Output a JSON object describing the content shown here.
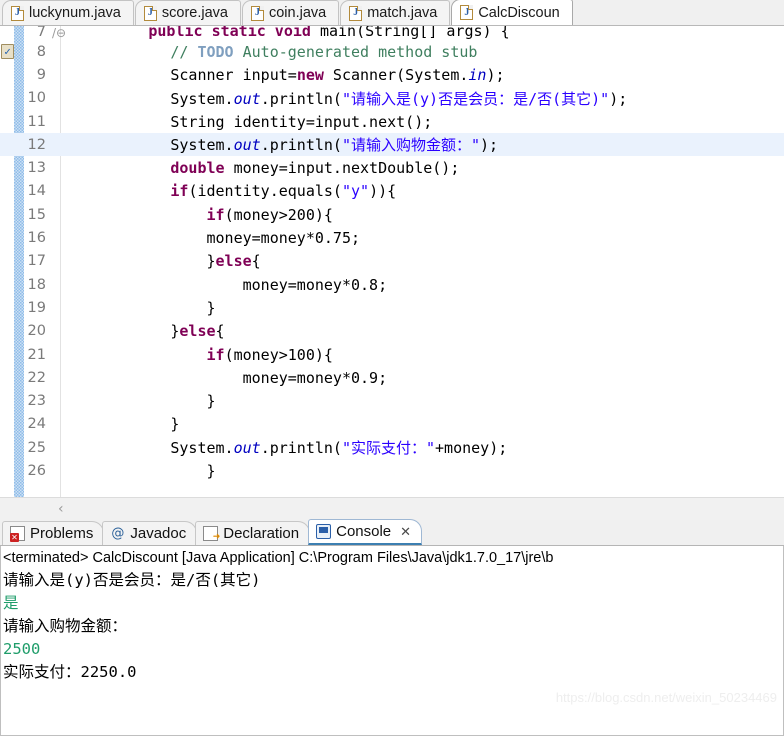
{
  "editor": {
    "tabs": [
      {
        "label": "luckynum.java",
        "icon": "java-file-icon",
        "active": false
      },
      {
        "label": "score.java",
        "icon": "java-file-icon",
        "active": false
      },
      {
        "label": "coin.java",
        "icon": "java-file-icon",
        "active": false
      },
      {
        "label": "match.java",
        "icon": "java-file-icon",
        "active": false
      },
      {
        "label": "CalcDiscoun",
        "icon": "java-file-icon",
        "active": true
      }
    ],
    "scroll_left_arrow": "‹",
    "lines": [
      {
        "num": "7",
        "marker": "fold-collapse-icon",
        "fold": "/⊖",
        "clipped": true,
        "tokens": [
          {
            "t": "        ",
            "c": "pln"
          },
          {
            "t": "public static void",
            "c": "kw"
          },
          {
            "t": " main(String[] args) {",
            "c": "pln"
          }
        ]
      },
      {
        "num": "8",
        "marker": "todo-task-marker",
        "highlight": false,
        "tokens": [
          {
            "t": "            ",
            "c": "pln"
          },
          {
            "t": "// ",
            "c": "cmt"
          },
          {
            "t": "TODO",
            "c": "todo"
          },
          {
            "t": " Auto-generated method stub",
            "c": "cmt"
          }
        ]
      },
      {
        "num": "9",
        "highlight": false,
        "tokens": [
          {
            "t": "            Scanner input=",
            "c": "pln"
          },
          {
            "t": "new",
            "c": "kw"
          },
          {
            "t": " Scanner(System.",
            "c": "pln"
          },
          {
            "t": "in",
            "c": "fld"
          },
          {
            "t": ");",
            "c": "pln"
          }
        ]
      },
      {
        "num": "10",
        "highlight": false,
        "tokens": [
          {
            "t": "            System.",
            "c": "pln"
          },
          {
            "t": "out",
            "c": "fld"
          },
          {
            "t": ".println(",
            "c": "pln"
          },
          {
            "t": "\"请输入是(y)否是会员：是/否(其它)\"",
            "c": "str"
          },
          {
            "t": ");",
            "c": "pln"
          }
        ]
      },
      {
        "num": "11",
        "highlight": false,
        "tokens": [
          {
            "t": "            String identity=input.next();",
            "c": "pln"
          }
        ]
      },
      {
        "num": "12",
        "highlight": true,
        "tokens": [
          {
            "t": "            System.",
            "c": "pln"
          },
          {
            "t": "out",
            "c": "fld"
          },
          {
            "t": ".println(",
            "c": "pln"
          },
          {
            "t": "\"请输入购物金额：\"",
            "c": "str"
          },
          {
            "t": ");",
            "c": "pln"
          }
        ]
      },
      {
        "num": "13",
        "highlight": false,
        "tokens": [
          {
            "t": "            ",
            "c": "pln"
          },
          {
            "t": "double",
            "c": "kw"
          },
          {
            "t": " money=input.nextDouble();",
            "c": "pln"
          }
        ]
      },
      {
        "num": "14",
        "highlight": false,
        "tokens": [
          {
            "t": "            ",
            "c": "pln"
          },
          {
            "t": "if",
            "c": "kw"
          },
          {
            "t": "(identity.equals(",
            "c": "pln"
          },
          {
            "t": "\"y\"",
            "c": "str"
          },
          {
            "t": ")){",
            "c": "pln"
          }
        ]
      },
      {
        "num": "15",
        "highlight": false,
        "tokens": [
          {
            "t": "                ",
            "c": "pln"
          },
          {
            "t": "if",
            "c": "kw"
          },
          {
            "t": "(money>200){",
            "c": "pln"
          }
        ]
      },
      {
        "num": "16",
        "highlight": false,
        "tokens": [
          {
            "t": "                money=money*0.75;",
            "c": "pln"
          }
        ]
      },
      {
        "num": "17",
        "highlight": false,
        "tokens": [
          {
            "t": "                }",
            "c": "pln"
          },
          {
            "t": "else",
            "c": "kw"
          },
          {
            "t": "{",
            "c": "pln"
          }
        ]
      },
      {
        "num": "18",
        "highlight": false,
        "tokens": [
          {
            "t": "                    money=money*0.8;",
            "c": "pln"
          }
        ]
      },
      {
        "num": "19",
        "highlight": false,
        "tokens": [
          {
            "t": "                }",
            "c": "pln"
          }
        ]
      },
      {
        "num": "20",
        "highlight": false,
        "tokens": [
          {
            "t": "            }",
            "c": "pln"
          },
          {
            "t": "else",
            "c": "kw"
          },
          {
            "t": "{",
            "c": "pln"
          }
        ]
      },
      {
        "num": "21",
        "highlight": false,
        "tokens": [
          {
            "t": "                ",
            "c": "pln"
          },
          {
            "t": "if",
            "c": "kw"
          },
          {
            "t": "(money>100){",
            "c": "pln"
          }
        ]
      },
      {
        "num": "22",
        "highlight": false,
        "tokens": [
          {
            "t": "                    money=money*0.9;",
            "c": "pln"
          }
        ]
      },
      {
        "num": "23",
        "highlight": false,
        "tokens": [
          {
            "t": "                }",
            "c": "pln"
          }
        ]
      },
      {
        "num": "24",
        "highlight": false,
        "tokens": [
          {
            "t": "            }",
            "c": "pln"
          }
        ]
      },
      {
        "num": "25",
        "highlight": false,
        "tokens": [
          {
            "t": "            System.",
            "c": "pln"
          },
          {
            "t": "out",
            "c": "fld"
          },
          {
            "t": ".println(",
            "c": "pln"
          },
          {
            "t": "\"实际支付：\"",
            "c": "str"
          },
          {
            "t": "+money);",
            "c": "pln"
          }
        ]
      },
      {
        "num": "26",
        "highlight": false,
        "tokens": [
          {
            "t": "                }",
            "c": "pln"
          }
        ]
      }
    ]
  },
  "bottom_view": {
    "tabs": [
      {
        "label": "Problems",
        "icon": "problems-icon",
        "active": false,
        "close": ""
      },
      {
        "label": "Javadoc",
        "icon": "javadoc-icon",
        "active": false,
        "close": ""
      },
      {
        "label": "Declaration",
        "icon": "declaration-icon",
        "active": false,
        "close": ""
      },
      {
        "label": "Console",
        "icon": "console-icon",
        "active": true,
        "close": "✕"
      }
    ],
    "console": {
      "lines": [
        {
          "text": "<terminated> CalcDiscount [Java Application] C:\\Program Files\\Java\\jdk1.7.0_17\\jre\\b",
          "kind": "header"
        },
        {
          "text": "请输入是(y)否是会员：是/否(其它)",
          "kind": "output"
        },
        {
          "text": "是",
          "kind": "input"
        },
        {
          "text": "请输入购物金额：",
          "kind": "output"
        },
        {
          "text": "2500",
          "kind": "input"
        },
        {
          "text": "实际支付：2250.0",
          "kind": "output"
        }
      ]
    }
  },
  "watermark": {
    "text": "https://blog.csdn.net/weixin_50234469"
  },
  "colors": {
    "keyword": "#7f0055",
    "string": "#2a00ff",
    "comment": "#3f7f5f",
    "field": "#0000c0",
    "console_input": "#1f9d6a",
    "active_tab_border": "#3c7fb1",
    "changebar": "#8fbce8",
    "current_line": "#eaf2fd"
  }
}
